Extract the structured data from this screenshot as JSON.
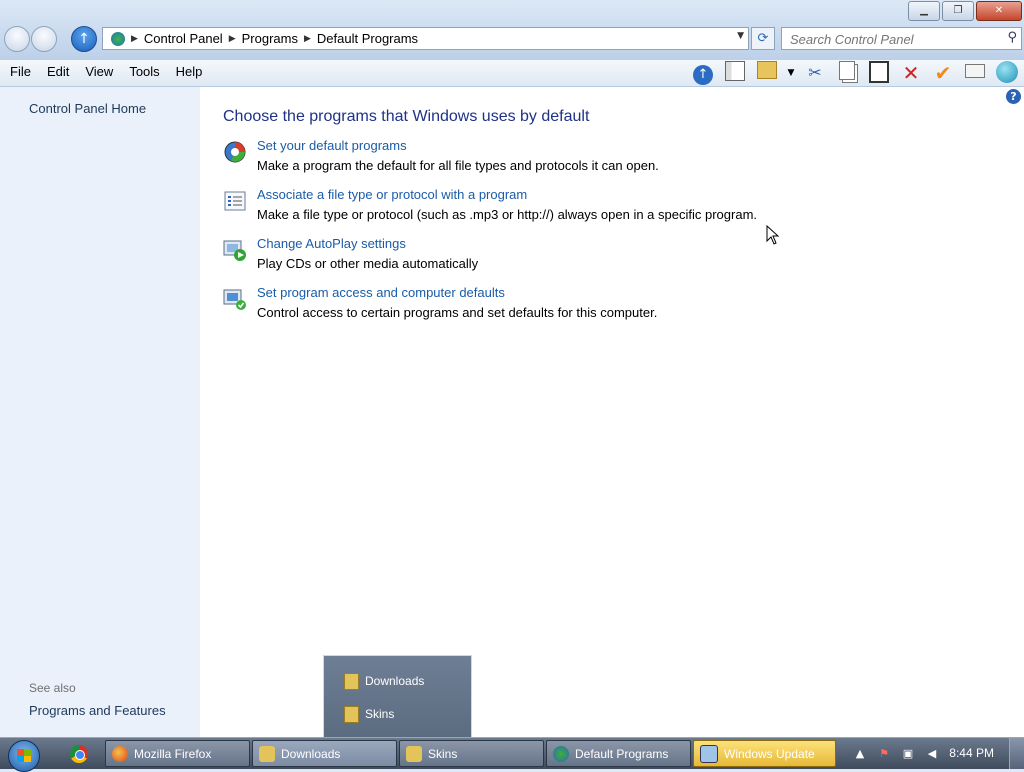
{
  "window": {
    "caption_buttons": {
      "minimize": "▁",
      "restore": "❐",
      "close": "✕"
    }
  },
  "address": {
    "crumbs": [
      "Control Panel",
      "Programs",
      "Default Programs"
    ]
  },
  "search": {
    "placeholder": "Search Control Panel"
  },
  "menu": {
    "items": [
      "File",
      "Edit",
      "View",
      "Tools",
      "Help"
    ]
  },
  "toolbar_icons": [
    "up-arrow-icon",
    "pane-icon",
    "folder-check-icon",
    "cut-icon",
    "copy-icon",
    "paste-icon",
    "delete-icon",
    "check-icon",
    "rename-icon",
    "globe-icon"
  ],
  "sidebar": {
    "home": "Control Panel Home",
    "see_also": "See also",
    "programs_features": "Programs and Features"
  },
  "main": {
    "heading": "Choose the programs that Windows uses by default",
    "items": [
      {
        "link": "Set your default programs",
        "desc": "Make a program the default for all file types and protocols it can open.",
        "icon": "default-programs-icon"
      },
      {
        "link": "Associate a file type or protocol with a program",
        "desc": "Make a file type or protocol (such as .mp3 or http://) always open in a specific program.",
        "icon": "file-association-icon"
      },
      {
        "link": "Change AutoPlay settings",
        "desc": "Play CDs or other media automatically",
        "icon": "autoplay-icon"
      },
      {
        "link": "Set program access and computer defaults",
        "desc": "Control access to certain programs and set defaults for this computer.",
        "icon": "program-access-icon"
      }
    ]
  },
  "popup": {
    "items": [
      "Downloads",
      "Skins"
    ]
  },
  "taskbar": {
    "buttons": [
      "Mozilla Firefox",
      "Downloads",
      "Skins",
      "Default Programs",
      "Windows Update"
    ],
    "clock": "8:44 PM"
  },
  "colors": {
    "link": "#1a5ca8",
    "heading": "#1e3287",
    "sidebar": "#eaf1fa"
  }
}
